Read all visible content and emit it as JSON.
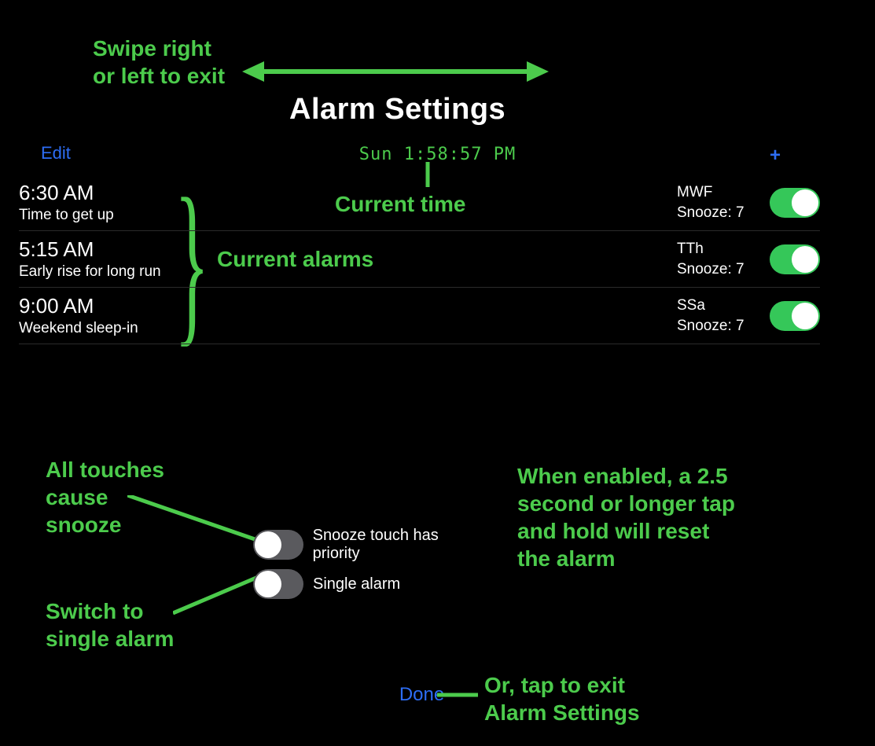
{
  "annotations": {
    "swipe": "Swipe right\nor left to exit",
    "current_time": "Current time",
    "current_alarms": "Current alarms",
    "all_touches": "All touches\ncause\nsnooze",
    "switch_single": "Switch to\nsingle alarm",
    "when_enabled": "When enabled, a 2.5\nsecond or longer tap\nand hold will reset\nthe alarm",
    "tap_exit": "Or, tap to exit\nAlarm Settings"
  },
  "header": {
    "title": "Alarm Settings",
    "edit": "Edit",
    "current_time": "Sun 1:58:57 PM"
  },
  "alarms": [
    {
      "time": "6:30 AM",
      "label": "Time to get up",
      "days": "MWF",
      "snooze": "Snooze: 7",
      "enabled": true
    },
    {
      "time": "5:15 AM",
      "label": "Early rise for long run",
      "days": "TTh",
      "snooze": "Snooze: 7",
      "enabled": true
    },
    {
      "time": "9:00 AM",
      "label": "Weekend sleep-in",
      "days": "SSa",
      "snooze": "Snooze: 7",
      "enabled": true
    }
  ],
  "options": {
    "snooze_priority": {
      "label": "Snooze touch has priority",
      "enabled": false
    },
    "single_alarm": {
      "label": "Single alarm",
      "enabled": false
    }
  },
  "footer": {
    "done": "Done"
  }
}
